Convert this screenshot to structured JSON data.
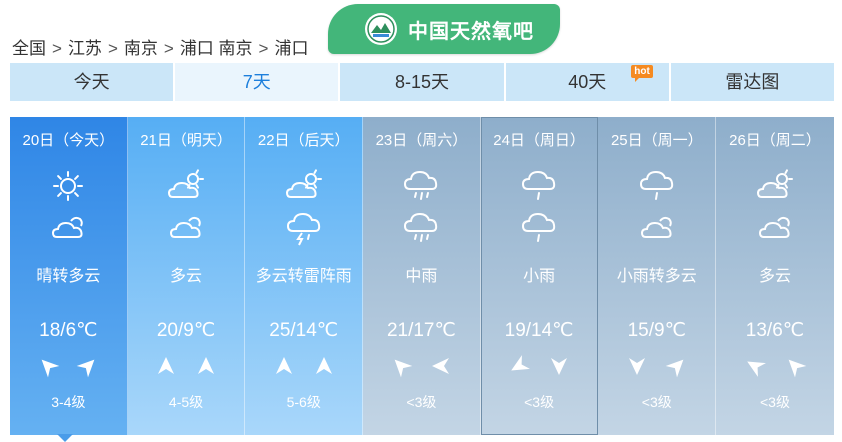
{
  "breadcrumb": [
    "全国",
    "江苏",
    "南京",
    "浦口 南京",
    "浦口"
  ],
  "breadcrumb_sep": ">",
  "badge": {
    "text": "中国天然氧吧",
    "color": "#43b67a"
  },
  "tabs": [
    {
      "label": "今天",
      "hot": ""
    },
    {
      "label": "7天",
      "hot": ""
    },
    {
      "label": "8-15天",
      "hot": ""
    },
    {
      "label": "40天",
      "hot": "hot"
    },
    {
      "label": "雷达图",
      "hot": ""
    }
  ],
  "active_tab": "7天",
  "days": [
    {
      "date": "20日（今天）",
      "icon1": "sun-icon",
      "icon2": "cloudy-icon",
      "desc": "晴转多云",
      "temp": "18/6℃",
      "wind1": "wind-arrow-icon",
      "wind2": "wind-arrow-icon",
      "level": "3-4级",
      "style": "today"
    },
    {
      "date": "21日（明天）",
      "icon1": "partly-cloudy-icon",
      "icon2": "cloudy-icon",
      "desc": "多云",
      "temp": "20/9℃",
      "wind1": "wind-arrow-icon",
      "wind2": "wind-arrow-icon",
      "level": "4-5级",
      "style": "future"
    },
    {
      "date": "22日（后天）",
      "icon1": "partly-cloudy-icon",
      "icon2": "thunder-shower-icon",
      "desc": "多云转雷阵雨",
      "temp": "25/14℃",
      "wind1": "wind-arrow-icon",
      "wind2": "wind-arrow-icon",
      "level": "5-6级",
      "style": "future"
    },
    {
      "date": "23日（周六）",
      "icon1": "rain-icon",
      "icon2": "rain-icon",
      "desc": "中雨",
      "temp": "21/17℃",
      "wind1": "wind-arrow-icon",
      "wind2": "wind-arrow-icon",
      "level": "<3级",
      "style": "gray"
    },
    {
      "date": "24日（周日）",
      "icon1": "light-rain-icon",
      "icon2": "light-rain-icon",
      "desc": "小雨",
      "temp": "19/14℃",
      "wind1": "wind-arrow-icon",
      "wind2": "wind-arrow-icon",
      "level": "<3级",
      "style": "gray"
    },
    {
      "date": "25日（周一）",
      "icon1": "light-rain-icon",
      "icon2": "cloudy-icon",
      "desc": "小雨转多云",
      "temp": "15/9℃",
      "wind1": "wind-arrow-icon",
      "wind2": "wind-arrow-icon",
      "level": "<3级",
      "style": "gray"
    },
    {
      "date": "26日（周二）",
      "icon1": "partly-cloudy-icon",
      "icon2": "cloudy-icon",
      "desc": "多云",
      "temp": "13/6℃",
      "wind1": "wind-arrow-icon",
      "wind2": "wind-arrow-icon",
      "level": "<3级",
      "style": "gray"
    }
  ],
  "colors": {
    "today": "#2f86e6",
    "future": "#56aef4",
    "past_style": "#8eaecb",
    "active_tab_text": "#1d7fdc",
    "hot": "#f58a21"
  }
}
